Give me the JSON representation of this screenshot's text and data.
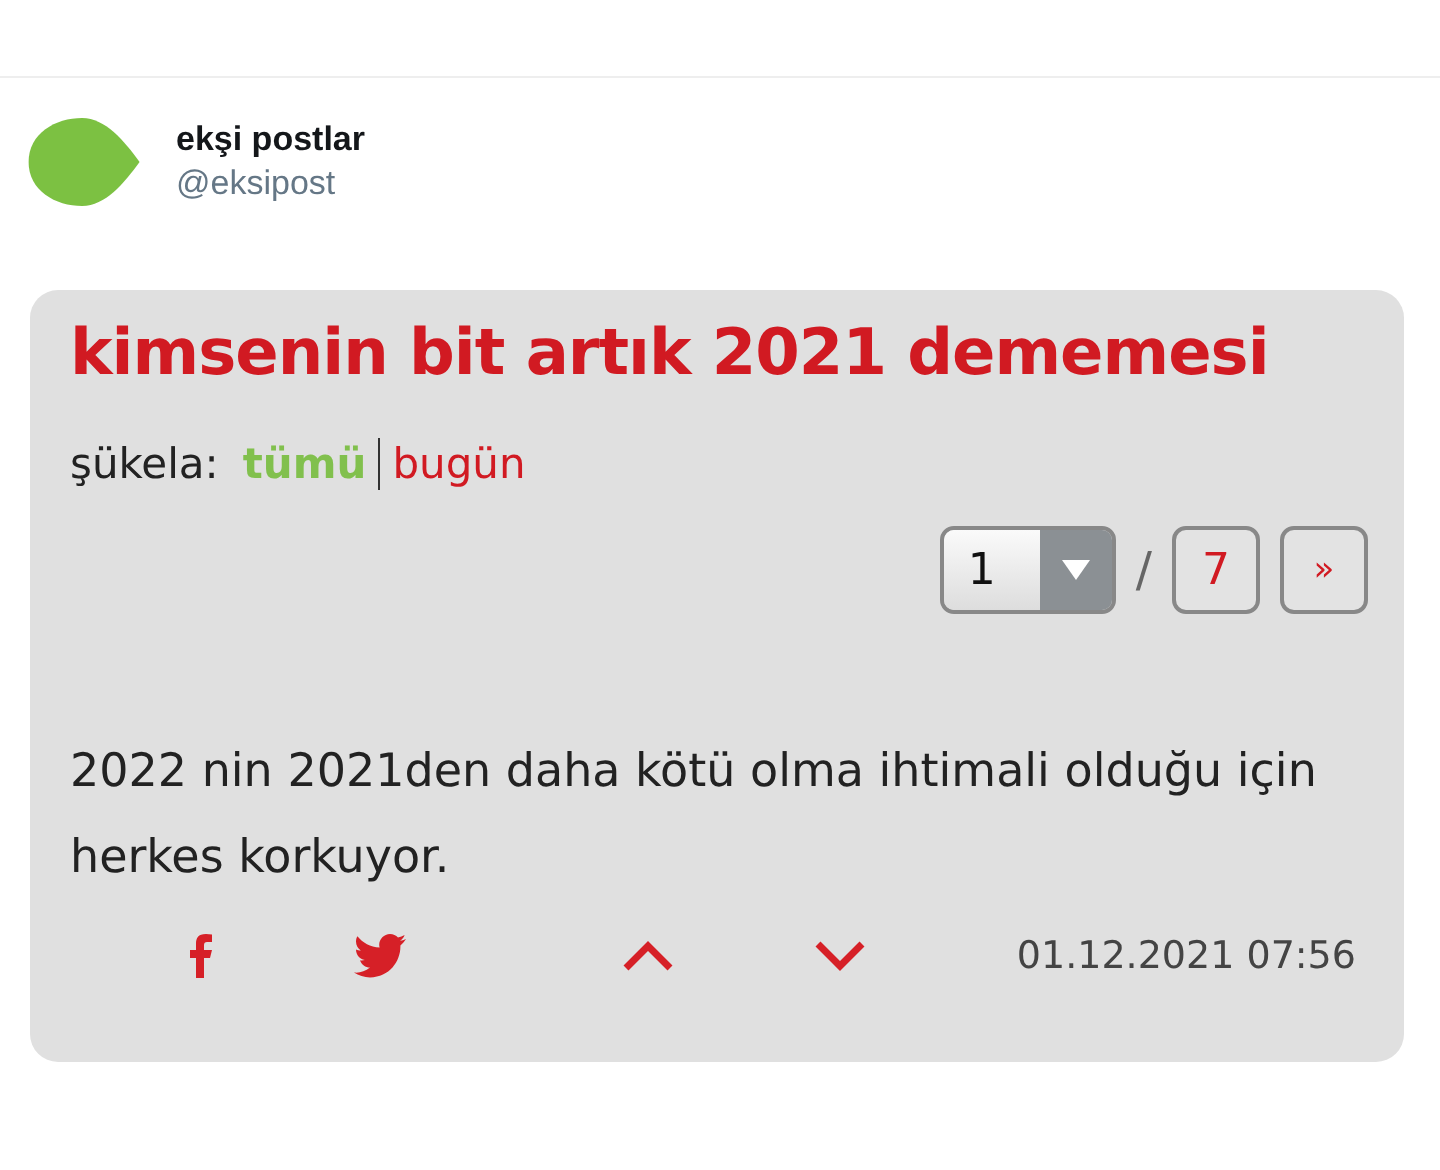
{
  "author": {
    "name": "ekşi postlar",
    "handle": "@eksipost"
  },
  "entry": {
    "title": "kimsenin bit artık 2021 dememesi",
    "filter_label": "şükela:",
    "filters": [
      {
        "label": "tümü",
        "selected": true
      },
      {
        "label": "bugün",
        "selected": false
      }
    ],
    "pager": {
      "page": "1",
      "separator": "/",
      "total": "7",
      "next": "»"
    },
    "text": "2022 nin 2021den daha kötü olma ihtimali olduğu için herkes korkuyor.",
    "date": "01.12.2021 07:56"
  }
}
